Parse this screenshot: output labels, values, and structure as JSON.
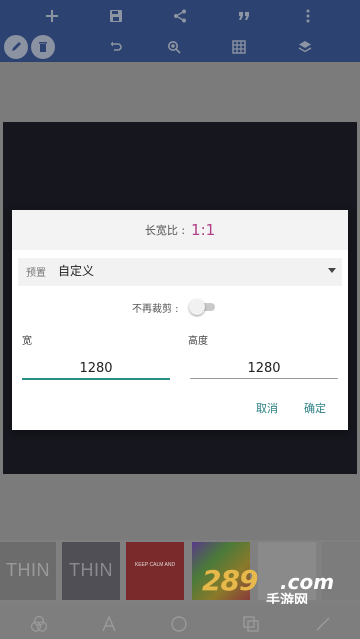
{
  "toolbar": {
    "row1_icons": [
      "add-icon",
      "save-icon",
      "share-icon",
      "quote-icon",
      "more-icon"
    ],
    "row2_icons": [
      "pencil-icon",
      "trash-icon",
      "undo-icon",
      "zoom-in-icon",
      "grid-icon",
      "layers-icon"
    ]
  },
  "dialog": {
    "ratio_label": "长宽比 :",
    "ratio_value": "1:1",
    "preset_label": "预置",
    "preset_value": "自定义",
    "no_crop_label": "不再裁剪 :",
    "no_crop_on": false,
    "width_label": "宽",
    "width_value": "1280",
    "height_label": "高度",
    "height_value": "1280",
    "cancel_label": "取消",
    "ok_label": "确定"
  },
  "thumbnails": {
    "items": [
      "THIN",
      "THIN",
      "KEEP CALM AND",
      "",
      ""
    ]
  },
  "watermark": {
    "number": "289",
    "suffix": ".com",
    "chinese": "手游网"
  },
  "bottom_tabs": {
    "icons": [
      "filters-icon",
      "text-icon",
      "shape-icon",
      "copy-icon",
      "brush-icon"
    ]
  },
  "colors": {
    "toolbar_bg": "#2c4270",
    "accent": "#2a8f86",
    "ratio_value": "#b03f86",
    "button_text": "#2a7f84"
  }
}
